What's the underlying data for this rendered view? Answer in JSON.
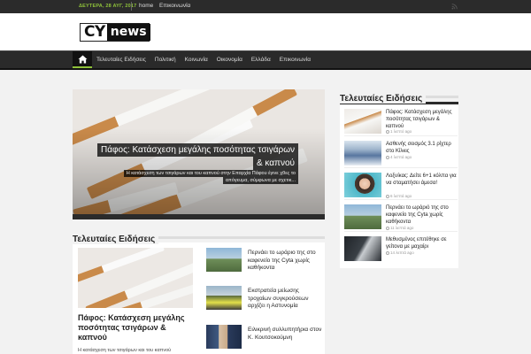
{
  "topbar": {
    "date": "ΔΕΥΤΕΡΑ, 28 ΑΥΓ, 2017",
    "links": [
      "home",
      "Επικοινωνία"
    ]
  },
  "logo": {
    "part1": "CY",
    "part2": "news"
  },
  "nav": {
    "items": [
      "Τελευταίες Ειδήσεις",
      "Πολιτική",
      "Κοινωνία",
      "Οικονομία",
      "Ελλάδα",
      "Επικοινωνία"
    ]
  },
  "slider": {
    "title_line1": "Πάφος: Κατάσχεση μεγάλης ποσότητας τσιγάρων",
    "title_line2": "& καπνού",
    "excerpt_line1": "Η κατάσχεση των τσιγάρων και του καπνού στην Επαρχία Πάφου έγινε χθες το",
    "excerpt_line2": "απόγευμα, σύμφωνα με σχετικ..."
  },
  "main": {
    "section_title": "Τελευταίες Ειδήσεις",
    "featured": {
      "title": "Πάφος: Κατάσχεση μεγάλης ποσότητας τσιγάρων & καπνού",
      "excerpt": "Η κατάσχεση των τσιγάρων και του καπνού"
    },
    "list": [
      {
        "title": "Περνάει το ωράριο της στο καφενείο της Cyta χωρίς καθήκοντα"
      },
      {
        "title": "Εκστρατεία μείωσης τροχαίων συγκρούσεων αρχίζει η Αστυνομία"
      },
      {
        "title": "Ειλικρινή συλλυπητήρια στον Κ. Κουτσοκούμνη"
      }
    ]
  },
  "sidebar": {
    "title": "Τελευταίες Ειδήσεις",
    "items": [
      {
        "title": "Πάφος: Κατάσχεση μεγάλης ποσότητας τσιγάρων & καπνού",
        "time": "1 λεπτό ago"
      },
      {
        "title": "Ασθενής σεισμός 3.1 ρίχτερ στο Κίλκις",
        "time": "4 λεπτά ago"
      },
      {
        "title": "Λοξυίκας: Δείτε 6+1 κόλπα για να σταματήσει άμεσα!",
        "time": "6 λεπτά ago"
      },
      {
        "title": "Περνάει το ωράριό της στο καφενείο της Cyta χωρίς καθήκοντα",
        "time": "11 λεπτά ago"
      },
      {
        "title": "Μεθυσμένος επιτέθηκε σε γείτονα με μαχαίρι",
        "time": "14 λεπτά ago"
      }
    ]
  },
  "colors": {
    "accent": "#8fc23a",
    "dark": "#2b2b2b"
  }
}
